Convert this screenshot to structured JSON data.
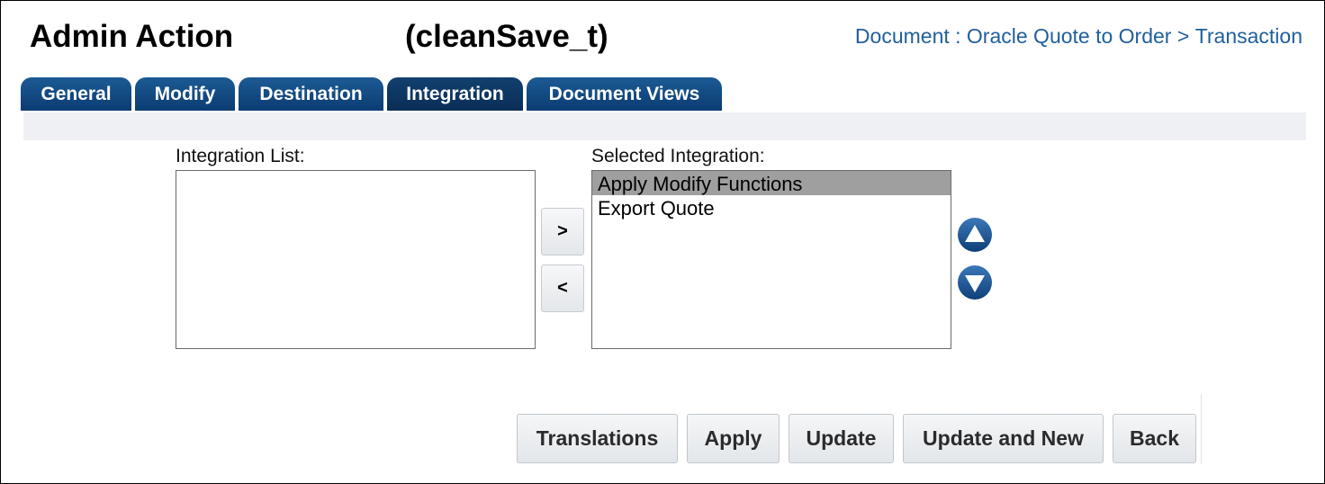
{
  "header": {
    "title": "Admin Action",
    "variable_name": "(cleanSave_t)",
    "breadcrumb": {
      "document": "Document : Oracle Quote to Order",
      "separator": " > ",
      "transaction": "Transaction"
    }
  },
  "tabs": [
    {
      "label": "General"
    },
    {
      "label": "Modify"
    },
    {
      "label": "Destination"
    },
    {
      "label": "Integration",
      "active": true
    },
    {
      "label": "Document Views"
    }
  ],
  "integration": {
    "list_label": "Integration List:",
    "list_items": [],
    "selected_label": "Selected Integration:",
    "selected_items": [
      {
        "label": "Apply Modify Functions",
        "selected": true
      },
      {
        "label": "Export Quote",
        "selected": false
      }
    ],
    "add_label": ">",
    "remove_label": "<",
    "move_up_icon": "arrow-up-circle",
    "move_down_icon": "arrow-down-circle"
  },
  "actions": {
    "translations": "Translations",
    "apply": "Apply",
    "update": "Update",
    "update_and_new": "Update and New",
    "back": "Back"
  },
  "colors": {
    "tab": "#0b3c72",
    "link": "#1f5f9e",
    "round_button": "#1b4f8a",
    "selected_row": "#9f9f9f"
  }
}
